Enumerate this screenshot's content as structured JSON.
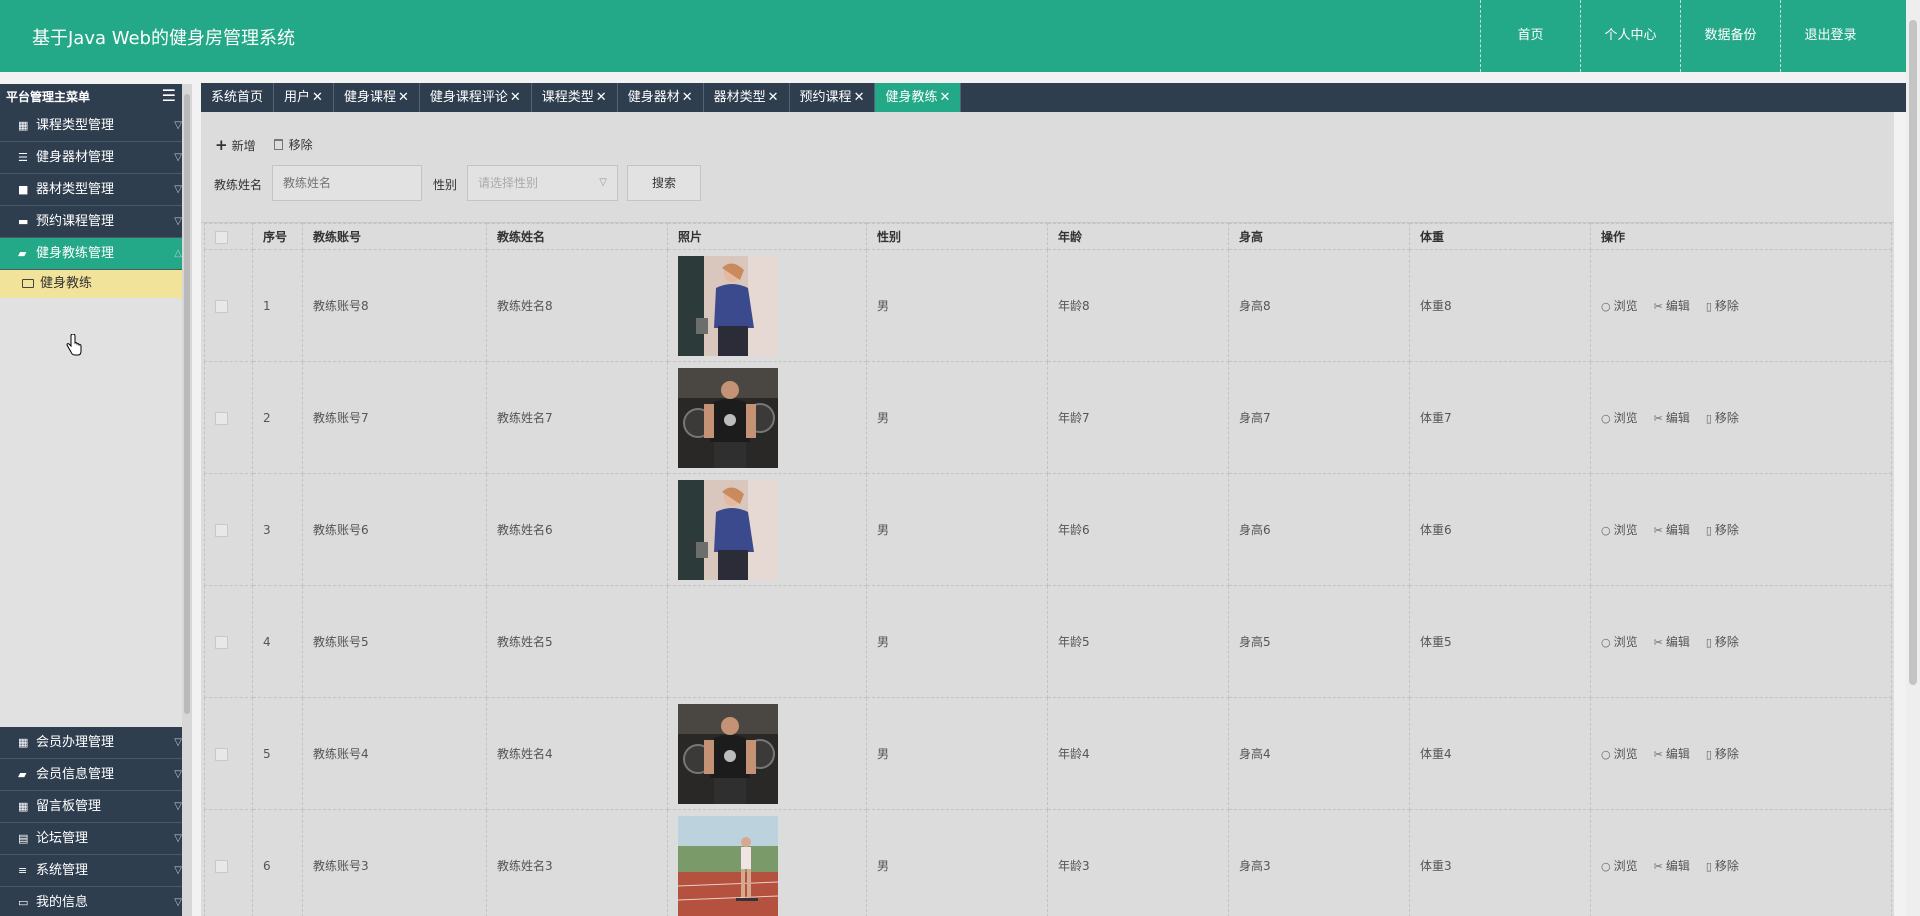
{
  "app": {
    "title": "基于Java Web的健身房管理系统",
    "nav": [
      "首页",
      "个人中心",
      "数据备份",
      "退出登录"
    ]
  },
  "sidebar": {
    "header": "平台管理主菜单",
    "items_top": [
      {
        "label": "课程类型管理",
        "icon": "grid-icon"
      },
      {
        "label": "健身器材管理",
        "icon": "sliders-icon"
      },
      {
        "label": "器材类型管理",
        "icon": "folder-icon"
      },
      {
        "label": "预约课程管理",
        "icon": "ticket-icon"
      },
      {
        "label": "健身教练管理",
        "icon": "chat-icon",
        "active": true
      }
    ],
    "subitem": "健身教练",
    "items_bottom": [
      {
        "label": "会员办理管理",
        "icon": "grid-icon"
      },
      {
        "label": "会员信息管理",
        "icon": "chat-icon"
      },
      {
        "label": "留言板管理",
        "icon": "grid-icon"
      },
      {
        "label": "论坛管理",
        "icon": "table-icon"
      },
      {
        "label": "系统管理",
        "icon": "menu-icon"
      },
      {
        "label": "我的信息",
        "icon": "window-icon"
      }
    ]
  },
  "tabs": [
    {
      "label": "系统首页",
      "closable": false
    },
    {
      "label": "用户",
      "closable": true
    },
    {
      "label": "健身课程",
      "closable": true
    },
    {
      "label": "健身课程评论",
      "closable": true
    },
    {
      "label": "课程类型",
      "closable": true
    },
    {
      "label": "健身器材",
      "closable": true
    },
    {
      "label": "器材类型",
      "closable": true
    },
    {
      "label": "预约课程",
      "closable": true
    },
    {
      "label": "健身教练",
      "closable": true,
      "active": true
    }
  ],
  "toolbar": {
    "add_label": "新增",
    "remove_label": "移除"
  },
  "search": {
    "name_label": "教练姓名",
    "name_placeholder": "教练姓名",
    "gender_label": "性别",
    "gender_placeholder": "请选择性别",
    "button_label": "搜索"
  },
  "table": {
    "headers": [
      "序号",
      "教练账号",
      "教练姓名",
      "照片",
      "性别",
      "年龄",
      "身高",
      "体重",
      "操作"
    ],
    "rows": [
      {
        "index": "1",
        "account": "教练账号8",
        "name": "教练姓名8",
        "photo": "woman-gym",
        "gender": "男",
        "age": "年龄8",
        "height": "身高8",
        "weight": "体重8"
      },
      {
        "index": "2",
        "account": "教练账号7",
        "name": "教练姓名7",
        "photo": "man-gym",
        "gender": "男",
        "age": "年龄7",
        "height": "身高7",
        "weight": "体重7"
      },
      {
        "index": "3",
        "account": "教练账号6",
        "name": "教练姓名6",
        "photo": "woman-gym",
        "gender": "男",
        "age": "年龄6",
        "height": "身高6",
        "weight": "体重6"
      },
      {
        "index": "4",
        "account": "教练账号5",
        "name": "教练姓名5",
        "photo": "loading",
        "gender": "男",
        "age": "年龄5",
        "height": "身高5",
        "weight": "体重5"
      },
      {
        "index": "5",
        "account": "教练账号4",
        "name": "教练姓名4",
        "photo": "man-gym",
        "gender": "男",
        "age": "年龄4",
        "height": "身高4",
        "weight": "体重4"
      },
      {
        "index": "6",
        "account": "教练账号3",
        "name": "教练姓名3",
        "photo": "woman-track",
        "gender": "男",
        "age": "年龄3",
        "height": "身高3",
        "weight": "体重3"
      }
    ],
    "actions": [
      "浏览",
      "编辑",
      "移除"
    ]
  },
  "colors": {
    "primary": "#23a888",
    "dark": "#2f3e4f",
    "highlight": "#f2e39a"
  }
}
